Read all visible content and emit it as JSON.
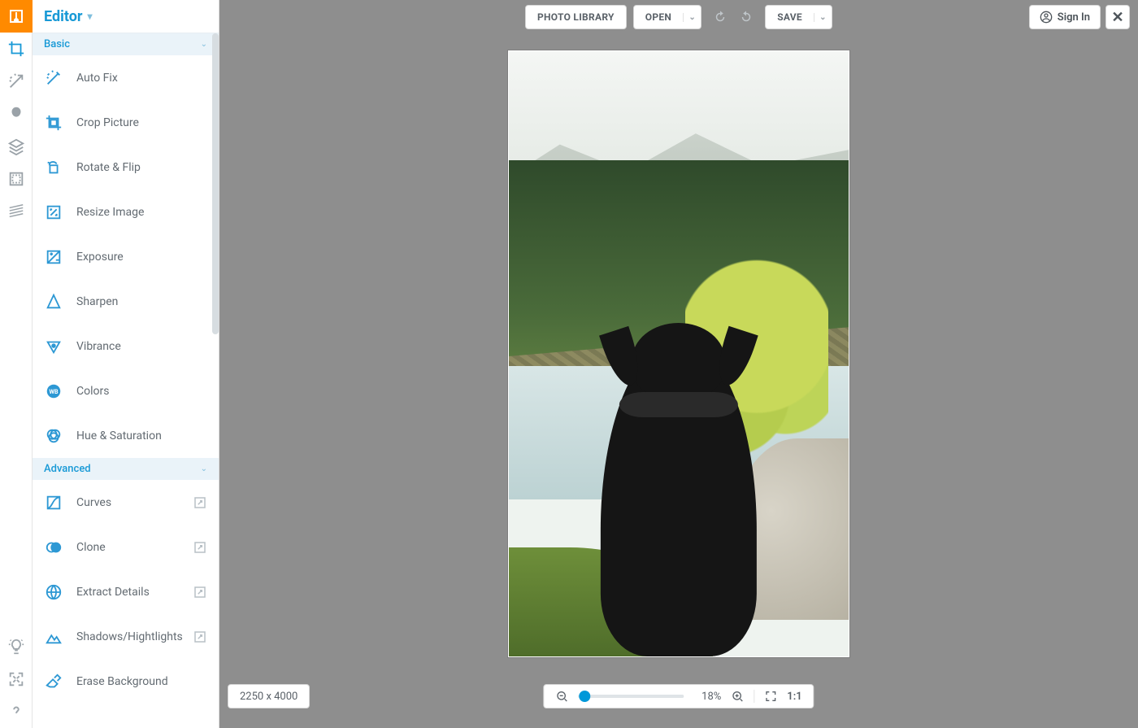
{
  "header": {
    "title": "Editor"
  },
  "rail": {
    "tools": [
      {
        "name": "crop-tool-icon",
        "active": true
      },
      {
        "name": "magic-tool-icon",
        "active": false
      },
      {
        "name": "portrait-tool-icon",
        "active": false
      },
      {
        "name": "layers-tool-icon",
        "active": false
      },
      {
        "name": "frame-tool-icon",
        "active": false
      },
      {
        "name": "texture-tool-icon",
        "active": false
      }
    ],
    "bottom": [
      {
        "name": "idea-icon"
      },
      {
        "name": "fullscreen-icon"
      },
      {
        "name": "help-icon"
      }
    ]
  },
  "groups": {
    "basic": {
      "label": "Basic"
    },
    "advanced": {
      "label": "Advanced"
    }
  },
  "basic_items": [
    {
      "icon": "wand-icon",
      "label": "Auto Fix"
    },
    {
      "icon": "crop-icon",
      "label": "Crop Picture"
    },
    {
      "icon": "rotate-icon",
      "label": "Rotate & Flip"
    },
    {
      "icon": "resize-icon",
      "label": "Resize Image"
    },
    {
      "icon": "exposure-icon",
      "label": "Exposure"
    },
    {
      "icon": "sharpen-icon",
      "label": "Sharpen"
    },
    {
      "icon": "vibrance-icon",
      "label": "Vibrance"
    },
    {
      "icon": "colors-icon",
      "label": "Colors"
    },
    {
      "icon": "hue-icon",
      "label": "Hue & Saturation"
    }
  ],
  "advanced_items": [
    {
      "icon": "curves-icon",
      "label": "Curves",
      "badge": true
    },
    {
      "icon": "clone-icon",
      "label": "Clone",
      "badge": true
    },
    {
      "icon": "extract-icon",
      "label": "Extract Details",
      "badge": true
    },
    {
      "icon": "shadows-icon",
      "label": "Shadows/Hightlights",
      "badge": true
    },
    {
      "icon": "erase-icon",
      "label": "Erase Background",
      "badge": false
    }
  ],
  "toolbar": {
    "photo_library": "PHOTO LIBRARY",
    "open": "OPEN",
    "save": "SAVE",
    "signin": "Sign In"
  },
  "canvas": {
    "dimensions": "2250 x 4000",
    "zoom_pct": "18%",
    "actual_label": "1:1"
  }
}
